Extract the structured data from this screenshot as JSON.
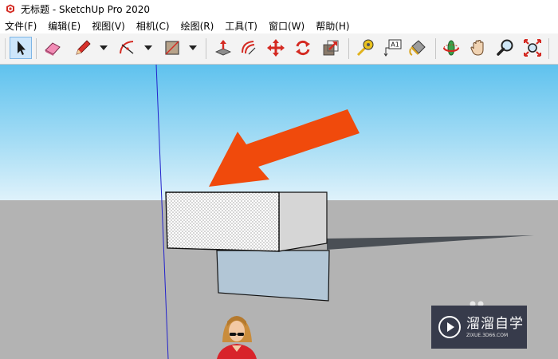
{
  "window": {
    "title": "无标题 - SketchUp Pro 2020",
    "icon": "sketchup-icon"
  },
  "menu": {
    "items": [
      "文件(F)",
      "编辑(E)",
      "视图(V)",
      "相机(C)",
      "绘图(R)",
      "工具(T)",
      "窗口(W)",
      "帮助(H)"
    ]
  },
  "toolbar": {
    "tools": [
      {
        "name": "select-tool",
        "icon": "arrow-cursor-icon",
        "active": true
      },
      {
        "name": "eraser-tool",
        "icon": "eraser-icon"
      },
      {
        "name": "line-tool",
        "icon": "pencil-icon",
        "has_dropdown": true
      },
      {
        "name": "arc-tool",
        "icon": "arc-icon",
        "has_dropdown": true
      },
      {
        "name": "rectangle-tool",
        "icon": "rectangle-icon",
        "has_dropdown": true
      },
      {
        "name": "push-pull-tool",
        "icon": "push-pull-icon"
      },
      {
        "name": "offset-tool",
        "icon": "offset-icon"
      },
      {
        "name": "move-tool",
        "icon": "move-icon"
      },
      {
        "name": "rotate-tool",
        "icon": "rotate-icon"
      },
      {
        "name": "scale-tool",
        "icon": "scale-icon"
      },
      {
        "name": "tape-measure-tool",
        "icon": "tape-measure-icon"
      },
      {
        "name": "text-tool",
        "icon": "text-label-icon",
        "label": "A1"
      },
      {
        "name": "paint-bucket-tool",
        "icon": "paint-bucket-icon"
      },
      {
        "name": "orbit-tool",
        "icon": "orbit-icon"
      },
      {
        "name": "pan-tool",
        "icon": "hand-icon"
      },
      {
        "name": "zoom-tool",
        "icon": "magnifier-icon"
      },
      {
        "name": "zoom-extents-tool",
        "icon": "zoom-extents-icon"
      }
    ]
  },
  "scene": {
    "sky_color": "#62c6ef",
    "ground_color": "#b3b3b3",
    "annotation_arrow_color": "#f04a0c",
    "selected_face": "dotted-front-face",
    "figure": "person-figure"
  },
  "watermark": {
    "brand": "溜溜自学",
    "url": "ZIXUE.3D66.COM"
  }
}
